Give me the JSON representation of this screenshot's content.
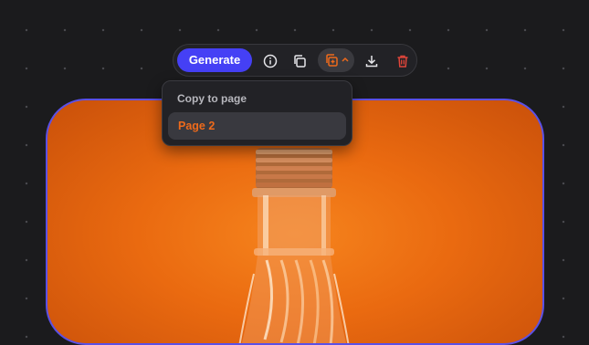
{
  "toolbar": {
    "generate_label": "Generate",
    "icons": [
      "info-icon",
      "duplicate-icon",
      "copy-to-page-icon",
      "chevron-up-icon",
      "download-icon",
      "trash-icon"
    ]
  },
  "copy_menu": {
    "title": "Copy to page",
    "items": [
      {
        "label": "Page 2",
        "color": "#ee6a1b"
      }
    ]
  },
  "colors": {
    "accent": "#4540f5",
    "selection_border": "#5b50e6",
    "danger": "#e0453a",
    "highlight": "#ee6a1b"
  }
}
